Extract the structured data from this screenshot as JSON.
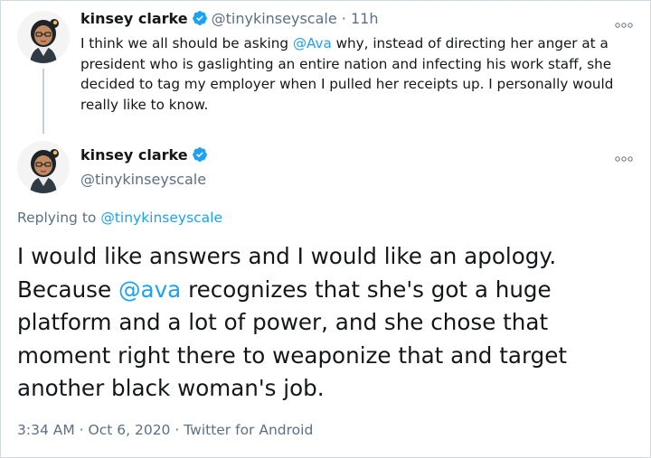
{
  "parent_tweet": {
    "author_name": "kinsey clarke",
    "handle": "@tinykinseyscale",
    "separator": "·",
    "time_ago": "11h",
    "text_parts": [
      "I think we all should be asking ",
      "@Ava",
      " why, instead of directing her anger at a president who is gaslighting an entire nation and infecting his work staff, she decided to tag my employer when I pulled her receipts up. I personally would really like to know."
    ]
  },
  "main_tweet": {
    "author_name": "kinsey clarke",
    "handle": "@tinykinseyscale",
    "replying_label": "Replying to ",
    "replying_handle": "@tinykinseyscale",
    "text_parts": [
      "I would like answers and I would like an apology. Because ",
      "@ava",
      " recognizes that she's got a huge platform and a lot of power, and she chose that moment right there to weaponize that and target another black woman's job."
    ],
    "time": "3:34 AM",
    "date": "Oct 6, 2020",
    "client": "Twitter for Android",
    "meta_separator": "·"
  },
  "colors": {
    "accent": "#1da1f2",
    "secondary_text": "#5b7083",
    "primary_text": "#14171a"
  },
  "icons": [
    "verified-badge-icon",
    "more-options-icon",
    "avatar"
  ]
}
